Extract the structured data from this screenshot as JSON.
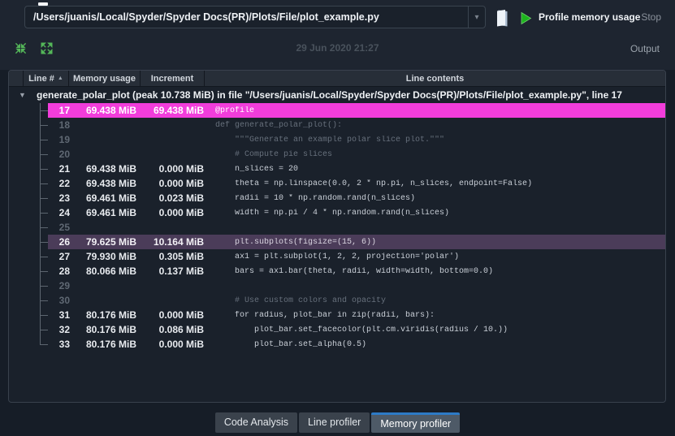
{
  "toolbar": {
    "file_path": "/Users/juanis/Local/Spyder/Spyder Docs(PR)/Plots/File/plot_example.py",
    "profile_button": "Profile memory usage",
    "stop_button": "Stop"
  },
  "statusbar": {
    "timestamp": "29 Jun 2020 21:27",
    "output_label": "Output"
  },
  "table": {
    "columns": [
      "Line #",
      "Memory usage",
      "Increment",
      "Line contents"
    ],
    "root_row": "generate_polar_plot (peak 10.738 MiB) in file \"/Users/juanis/Local/Spyder/Spyder Docs(PR)/Plots/File/plot_example.py\", line 17",
    "rows": [
      {
        "line": "17",
        "memory": "69.438 MiB",
        "increment": "69.438 MiB",
        "code": "@profile",
        "state": "selected"
      },
      {
        "line": "18",
        "memory": "",
        "increment": "",
        "code": "def generate_polar_plot():",
        "state": "dim"
      },
      {
        "line": "19",
        "memory": "",
        "increment": "",
        "code": "    \"\"\"Generate an example polar slice plot.\"\"\"",
        "state": "dim"
      },
      {
        "line": "20",
        "memory": "",
        "increment": "",
        "code": "    # Compute pie slices",
        "state": "dim"
      },
      {
        "line": "21",
        "memory": "69.438 MiB",
        "increment": "0.000 MiB",
        "code": "    n_slices = 20",
        "state": "normal"
      },
      {
        "line": "22",
        "memory": "69.438 MiB",
        "increment": "0.000 MiB",
        "code": "    theta = np.linspace(0.0, 2 * np.pi, n_slices, endpoint=False)",
        "state": "normal"
      },
      {
        "line": "23",
        "memory": "69.461 MiB",
        "increment": "0.023 MiB",
        "code": "    radii = 10 * np.random.rand(n_slices)",
        "state": "normal"
      },
      {
        "line": "24",
        "memory": "69.461 MiB",
        "increment": "0.000 MiB",
        "code": "    width = np.pi / 4 * np.random.rand(n_slices)",
        "state": "normal"
      },
      {
        "line": "25",
        "memory": "",
        "increment": "",
        "code": "",
        "state": "dim"
      },
      {
        "line": "26",
        "memory": "79.625 MiB",
        "increment": "10.164 MiB",
        "code": "    plt.subplots(figsize=(15, 6))",
        "state": "hot"
      },
      {
        "line": "27",
        "memory": "79.930 MiB",
        "increment": "0.305 MiB",
        "code": "    ax1 = plt.subplot(1, 2, 2, projection='polar')",
        "state": "normal"
      },
      {
        "line": "28",
        "memory": "80.066 MiB",
        "increment": "0.137 MiB",
        "code": "    bars = ax1.bar(theta, radii, width=width, bottom=0.0)",
        "state": "normal"
      },
      {
        "line": "29",
        "memory": "",
        "increment": "",
        "code": "",
        "state": "dim"
      },
      {
        "line": "30",
        "memory": "",
        "increment": "",
        "code": "    # Use custom colors and opacity",
        "state": "dim"
      },
      {
        "line": "31",
        "memory": "80.176 MiB",
        "increment": "0.000 MiB",
        "code": "    for radius, plot_bar in zip(radii, bars):",
        "state": "normal"
      },
      {
        "line": "32",
        "memory": "80.176 MiB",
        "increment": "0.086 MiB",
        "code": "        plot_bar.set_facecolor(plt.cm.viridis(radius / 10.))",
        "state": "normal"
      },
      {
        "line": "33",
        "memory": "80.176 MiB",
        "increment": "0.000 MiB",
        "code": "        plot_bar.set_alpha(0.5)",
        "state": "normal"
      }
    ]
  },
  "tabs": [
    {
      "label": "Code Analysis",
      "selected": false
    },
    {
      "label": "Line profiler",
      "selected": false
    },
    {
      "label": "Memory profiler",
      "selected": true
    }
  ],
  "icons": {
    "combo_arrow": "▾",
    "expander": "▼",
    "sort": "▲"
  },
  "colors": {
    "selected_row": "#f23ddb",
    "hot_row": "#4b3c59",
    "accent_green": "#54b759",
    "play_green": "#1db41d",
    "tab_accent_blue": "#2d7ac6"
  }
}
